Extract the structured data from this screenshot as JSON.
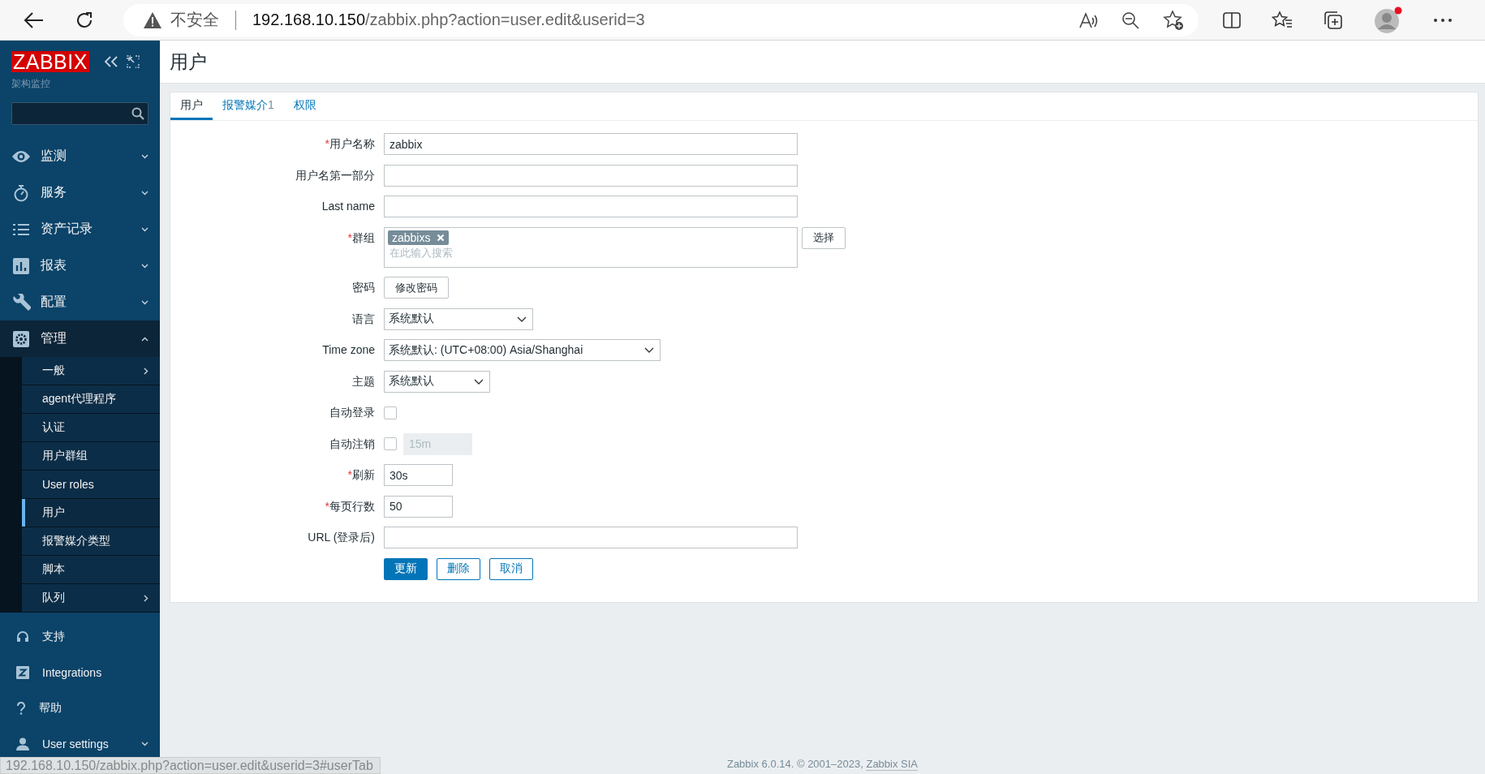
{
  "browser": {
    "security": "不安全",
    "url_host": "192.168.10.150",
    "url_path": "/zabbix.php?action=user.edit&userid=3",
    "profile_notification": true
  },
  "sidebar": {
    "logo": "ZABBIX",
    "subtitle": "架构监控",
    "menu": [
      {
        "label": "监测",
        "expanded": false
      },
      {
        "label": "服务",
        "expanded": false
      },
      {
        "label": "资产记录",
        "expanded": false
      },
      {
        "label": "报表",
        "expanded": false
      },
      {
        "label": "配置",
        "expanded": false
      },
      {
        "label": "管理",
        "expanded": true,
        "children": [
          {
            "label": "一般",
            "selected": false,
            "submenu": true
          },
          {
            "label": "agent代理程序",
            "selected": false,
            "submenu": false
          },
          {
            "label": "认证",
            "selected": false,
            "submenu": false
          },
          {
            "label": "用户群组",
            "selected": false,
            "submenu": false
          },
          {
            "label": "User roles",
            "selected": false,
            "submenu": false
          },
          {
            "label": "用户",
            "selected": true,
            "submenu": false
          },
          {
            "label": "报警媒介类型",
            "selected": false,
            "submenu": false
          },
          {
            "label": "脚本",
            "selected": false,
            "submenu": false
          },
          {
            "label": "队列",
            "selected": false,
            "submenu": true
          }
        ]
      }
    ],
    "bottom": [
      {
        "label": "支持"
      },
      {
        "label": "Integrations"
      },
      {
        "label": "帮助"
      },
      {
        "label": "User settings",
        "expanded": false
      }
    ]
  },
  "page": {
    "title": "用户",
    "tabs": [
      {
        "label": "用户",
        "selected": true
      },
      {
        "label": "报警媒介",
        "count": "1",
        "selected": false
      },
      {
        "label": "权限",
        "selected": false
      }
    ],
    "fields": [
      {
        "kind": "text",
        "marker": "*",
        "label": "用户名称",
        "value": "zabbix"
      },
      {
        "kind": "text",
        "label": "用户名第一部分"
      },
      {
        "kind": "text",
        "label": "Last name"
      },
      {
        "kind": "multiselect",
        "marker": "*",
        "label": "群组",
        "tags": [
          "zabbixs"
        ],
        "placeholder": "在此输入搜索",
        "button": "选择"
      },
      {
        "kind": "button",
        "label": "密码",
        "button": "修改密码"
      },
      {
        "kind": "select",
        "label": "语言",
        "value": "系统默认"
      },
      {
        "kind": "select",
        "label": "Time zone",
        "value": "系统默认: (UTC+08:00) Asia/Shanghai"
      },
      {
        "kind": "select",
        "label": "主题",
        "value": "系统默认"
      },
      {
        "kind": "checkbox",
        "label": "自动登录",
        "checked": false
      },
      {
        "kind": "checkbox_input",
        "label": "自动注销",
        "checked": false,
        "value": "15m"
      },
      {
        "kind": "text",
        "marker": "*",
        "label": "刷新",
        "value": "30s"
      },
      {
        "kind": "text",
        "marker": "*",
        "label": "每页行数",
        "value": "50"
      },
      {
        "kind": "text",
        "label": "URL (登录后)"
      }
    ],
    "actions": [
      {
        "label": "更新",
        "primary": true
      },
      {
        "label": "删除",
        "primary": false
      },
      {
        "label": "取消",
        "primary": false
      }
    ]
  },
  "footer": {
    "text": "Zabbix 6.0.14. © 2001–2023,",
    "link": "Zabbix SIA"
  },
  "status_url": "192.168.10.150/zabbix.php?action=user.edit&userid=3#userTab"
}
